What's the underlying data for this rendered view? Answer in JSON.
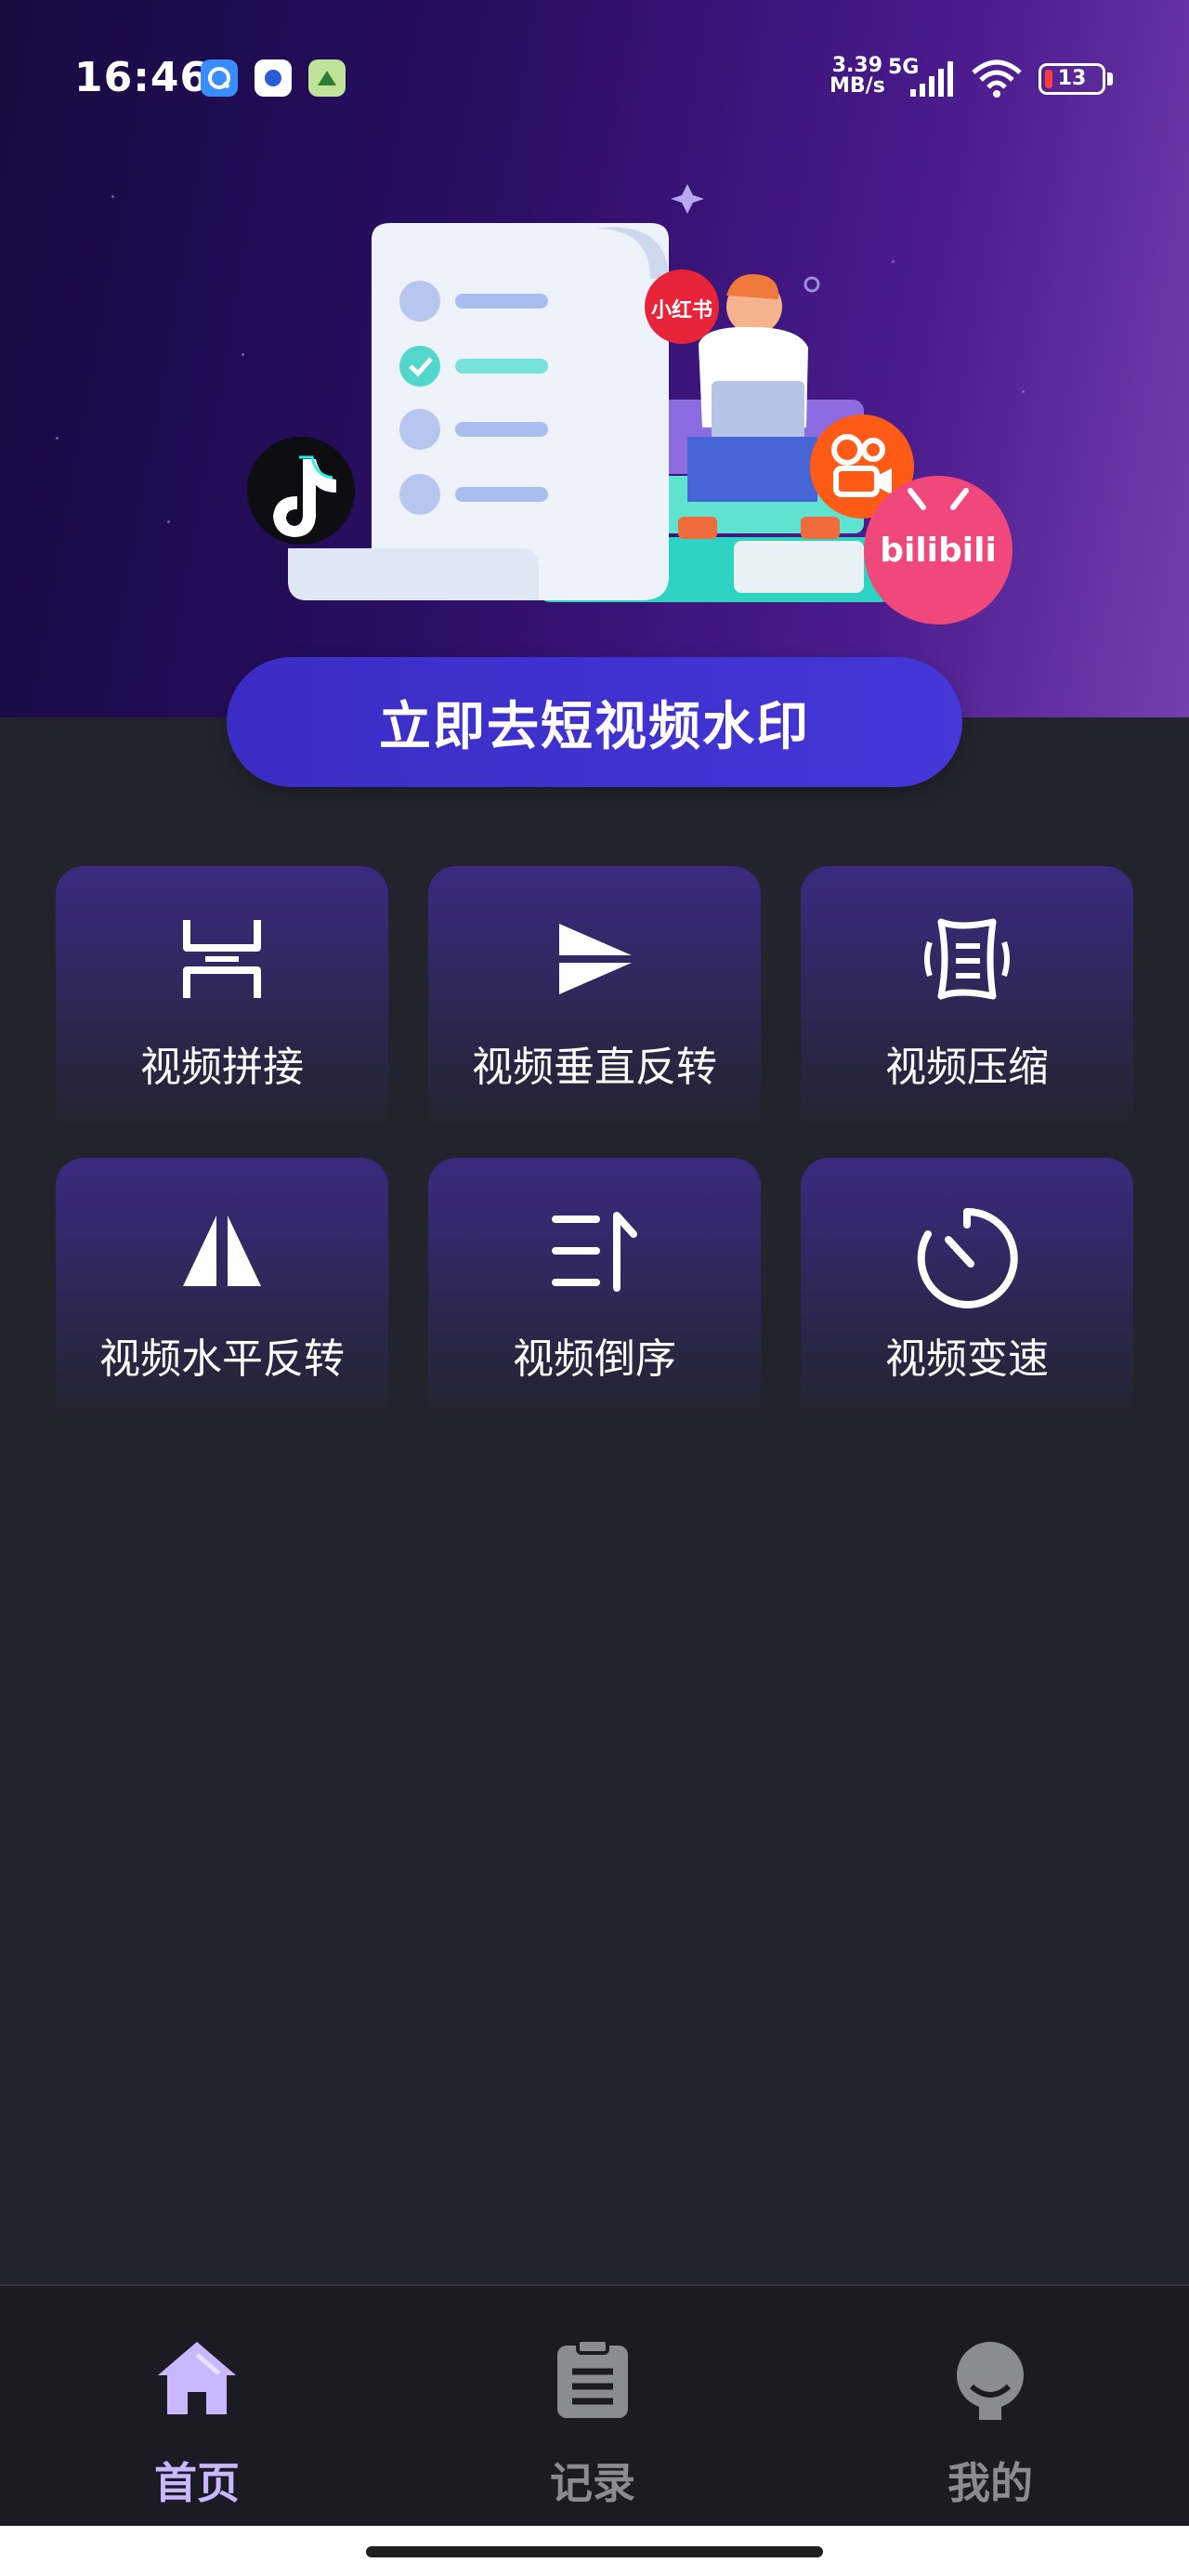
{
  "status_bar": {
    "time": "16:46",
    "net_speed_value": "3.39",
    "net_speed_unit": "MB/s",
    "network_type": "5G",
    "battery_level": "13"
  },
  "hero": {
    "platform_badges": [
      "小红书",
      "bilibili"
    ],
    "cta_label": "立即去短视频水印"
  },
  "features": [
    {
      "label": "视频拼接",
      "icon": "merge-icon"
    },
    {
      "label": "视频垂直反转",
      "icon": "vertical-flip-icon"
    },
    {
      "label": "视频压缩",
      "icon": "compress-icon"
    },
    {
      "label": "视频水平反转",
      "icon": "horizontal-flip-icon"
    },
    {
      "label": "视频倒序",
      "icon": "reverse-icon"
    },
    {
      "label": "视频变速",
      "icon": "speed-icon"
    }
  ],
  "bottom_nav": {
    "items": [
      {
        "label": "首页",
        "icon": "home-icon",
        "active": true
      },
      {
        "label": "记录",
        "icon": "clipboard-icon",
        "active": false
      },
      {
        "label": "我的",
        "icon": "profile-icon",
        "active": false
      }
    ],
    "active_color": "#c9b8ff",
    "inactive_color": "#8b8b93"
  },
  "colors": {
    "accent": "#3f2fd0",
    "background": "#23232d"
  }
}
